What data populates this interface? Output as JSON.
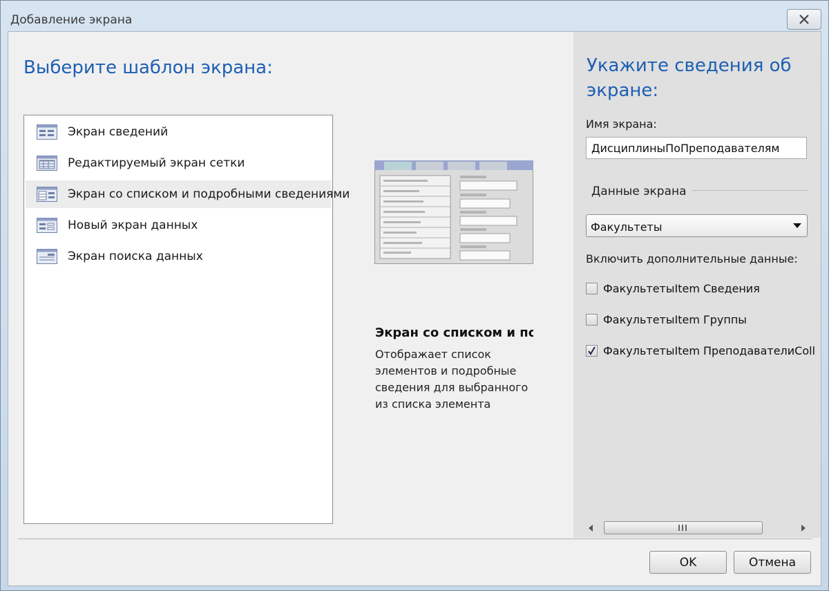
{
  "window": {
    "title": "Добавление экрана"
  },
  "left": {
    "heading": "Выберите шаблон экрана:",
    "templates": [
      {
        "label": "Экран сведений",
        "icon": "details-screen-icon"
      },
      {
        "label": "Редактируемый экран сетки",
        "icon": "grid-screen-icon"
      },
      {
        "label": "Экран со списком и подробными сведениями",
        "icon": "list-details-screen-icon",
        "selected": true
      },
      {
        "label": "Новый экран данных",
        "icon": "new-data-screen-icon"
      },
      {
        "label": "Экран поиска данных",
        "icon": "search-data-screen-icon"
      }
    ]
  },
  "preview": {
    "title": "Экран со списком и подробными сведениями",
    "description": "Отображает список элементов и подробные сведения для выбранного из списка элемента"
  },
  "right": {
    "heading": "Укажите сведения об экране:",
    "name_label": "Имя экрана:",
    "name_value": "ДисциплиныПоПреподавателям",
    "group_label": "Данные экрана",
    "data_select": "Факультеты",
    "include_label": "Включить дополнительные данные:",
    "checkboxes": [
      {
        "label": "ФакультетыItem Сведения",
        "checked": false
      },
      {
        "label": "ФакультетыItem Группы",
        "checked": false
      },
      {
        "label": "ФакультетыItem ПреподавателиColl",
        "checked": true
      }
    ]
  },
  "buttons": {
    "ok": "OK",
    "cancel": "Отмена"
  },
  "colors": {
    "heading": "#1e5fb3",
    "preview_header": "#9aa6cf",
    "preview_tab": "#b8d3d7"
  }
}
